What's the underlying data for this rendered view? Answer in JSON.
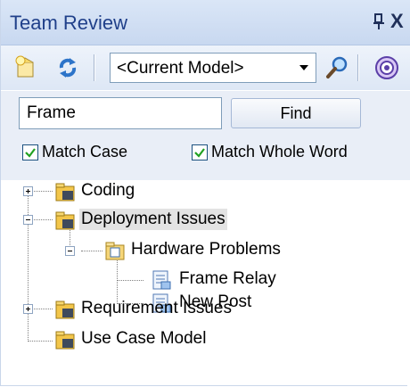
{
  "window": {
    "title": "Team Review",
    "pin_icon": "pin-icon",
    "close_glyph": "X"
  },
  "toolbar": {
    "buttons": [
      {
        "name": "new-item-icon"
      },
      {
        "name": "refresh-icon"
      },
      {
        "name": "search-icon"
      },
      {
        "name": "help-icon"
      }
    ],
    "model_select": {
      "value": "<Current Model>"
    }
  },
  "search": {
    "input_value": "Frame",
    "find_label": "Find",
    "match_case": {
      "label": "Match Case",
      "checked": true
    },
    "match_whole_word": {
      "label": "Match Whole Word",
      "checked": true
    }
  },
  "tree": {
    "nodes": [
      {
        "label": "Coding",
        "icon": "package-folder-icon",
        "expander": "plus",
        "level": 0
      },
      {
        "label": "Deployment Issues",
        "icon": "package-folder-icon",
        "expander": "minus",
        "level": 0,
        "selected": true
      },
      {
        "label": "Hardware Problems",
        "icon": "category-folder-icon",
        "expander": "minus",
        "level": 1
      },
      {
        "label": "Frame Relay",
        "icon": "post-document-icon",
        "level": 2
      },
      {
        "label": "New Post",
        "icon": "post-document-icon",
        "level": 2
      },
      {
        "label": "Requirement Issues",
        "icon": "package-folder-icon",
        "expander": "plus",
        "level": 0
      },
      {
        "label": "Use Case Model",
        "icon": "package-folder-icon",
        "level": 0
      }
    ]
  }
}
